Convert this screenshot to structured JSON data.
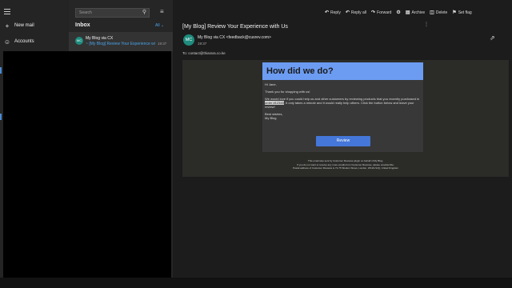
{
  "nav": {
    "new_mail": "New mail",
    "accounts": "Accounts"
  },
  "list": {
    "search_placeholder": "Search",
    "folder_title": "Inbox",
    "filter_label": "All",
    "items": [
      {
        "avatar": "MC",
        "sender": "My Blog via CX",
        "subject": "[My Blog] Review Your Experience wi",
        "time": "19:37"
      }
    ]
  },
  "toolbar": {
    "reply": "Reply",
    "reply_all": "Reply all",
    "forward": "Forward",
    "archive": "Archive",
    "delete": "Delete",
    "set_flag": "Set flag"
  },
  "message": {
    "subject": "[My Blog] Review Your Experience with Us",
    "avatar": "MC",
    "from": "My Blog via CX <feedback@cusrev.com>",
    "date": "19:37",
    "to": "To: contact@thiarara.co.ke"
  },
  "email": {
    "banner": "How did we do?",
    "greeting": "Hi Jane,",
    "thanks": "Thank you for shopping with us!",
    "body_before": "We would love if you could help us and other customers by reviewing products that you recently purchased in ",
    "order_ref": "order #12345",
    "body_after": ". It only takes a minute and it would really help others. Click the button below and leave your review!",
    "signoff": "Best wishes,",
    "signature": "My Blog",
    "button": "Review",
    "footer_1": "This email was sent by Customer Reviews plugin on behalf of My Blog.",
    "footer_2": "If you do not want to receive any more emails from Customer Reviews, please unsubscribe.",
    "footer_3": "Postal address of Customer Reviews is 71-75 Shelton Street, London, WC2H 9JQ, United Kingdom"
  },
  "colors": {
    "accent": "#4a8bd4",
    "banner": "#6c9cf2",
    "button": "#4477d9",
    "avatar": "#1e8c7e"
  }
}
